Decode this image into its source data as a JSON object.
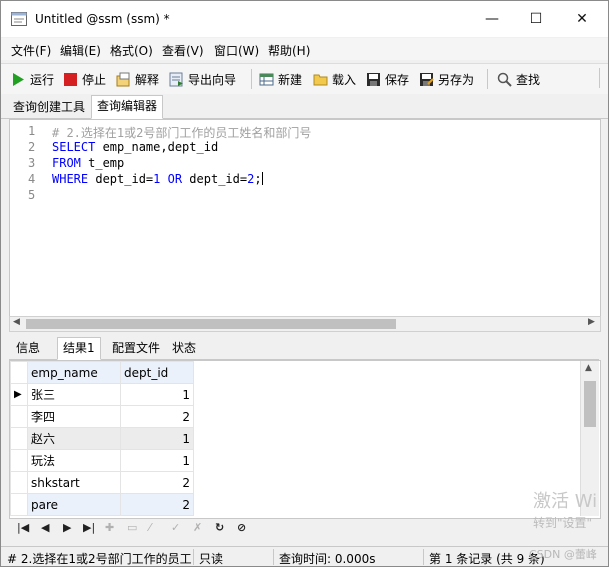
{
  "window": {
    "title": "Untitled @ssm (ssm) *",
    "controls": {
      "minimize": "—",
      "maximize": "☐",
      "close": "✕"
    }
  },
  "menu": [
    "文件(F)",
    "编辑(E)",
    "格式(O)",
    "查看(V)",
    "窗口(W)",
    "帮助(H)"
  ],
  "toolbar": {
    "run": "运行",
    "stop": "停止",
    "explain": "解释",
    "export": "导出向导",
    "new": "新建",
    "load": "载入",
    "save": "保存",
    "save_as": "另存为",
    "find": "查找"
  },
  "top_tabs": [
    "查询创建工具",
    "查询编辑器"
  ],
  "editor": {
    "line_numbers": [
      "1",
      "2",
      "3",
      "4",
      "5"
    ],
    "comment": "# 2.选择在1或2号部门工作的员工姓名和部门号",
    "line2_kw": "SELECT",
    "line2_rest": " emp_name,dept_id",
    "line3_kw": "FROM",
    "line3_rest": " t_emp",
    "line4_kw1": "WHERE",
    "line4_a": " dept_id=",
    "line4_n1": "1",
    "line4_kw2": " OR",
    "line4_b": " dept_id=",
    "line4_n2": "2",
    "line4_end": ";"
  },
  "result_tabs": [
    "信息",
    "结果1",
    "配置文件",
    "状态"
  ],
  "grid": {
    "columns": [
      "emp_name",
      "dept_id"
    ],
    "rows": [
      [
        "张三",
        "1"
      ],
      [
        "李四",
        "2"
      ],
      [
        "赵六",
        "1"
      ],
      [
        "玩法",
        "1"
      ],
      [
        "shkstart",
        "2"
      ],
      [
        "pare",
        "2"
      ]
    ],
    "current_row_marker": "▶"
  },
  "navigator": [
    "|◀",
    "◀",
    "▶",
    "▶|",
    "✚",
    "▭",
    "⁄",
    "✓",
    "✗",
    "↻",
    "⊘"
  ],
  "status": {
    "query": "# 2.选择在1或2号部门工作的员工",
    "mode": "只读",
    "time": "查询时间: 0.000s",
    "records": "第 1 条记录 (共 9 条)"
  },
  "watermark": {
    "line1": "激活 Wi",
    "line2": "转到\"设置\"",
    "credit": "CSDN @蕾峰"
  },
  "colors": {
    "keyword": "#0000ff",
    "comment": "#a0a0a0",
    "header_bg": "#eaf1fa",
    "run": "#22a022",
    "stop": "#d42020"
  }
}
